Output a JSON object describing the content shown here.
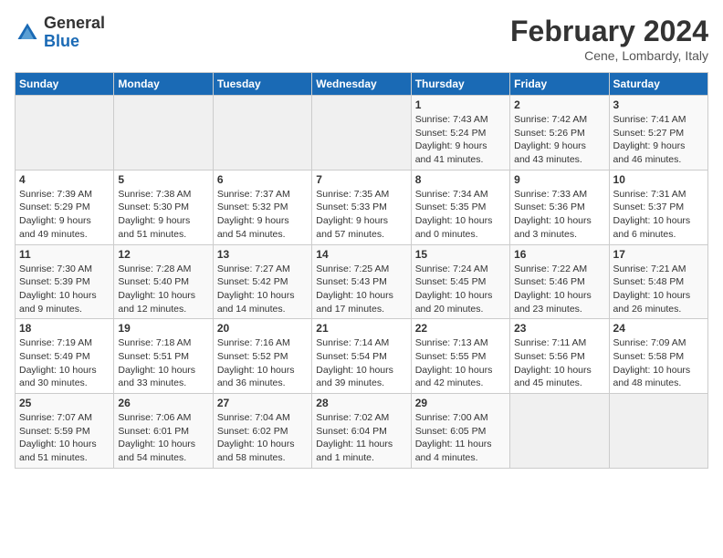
{
  "header": {
    "logo": {
      "general": "General",
      "blue": "Blue"
    },
    "title": "February 2024",
    "location": "Cene, Lombardy, Italy"
  },
  "calendar": {
    "days_of_week": [
      "Sunday",
      "Monday",
      "Tuesday",
      "Wednesday",
      "Thursday",
      "Friday",
      "Saturday"
    ],
    "weeks": [
      [
        {
          "day": "",
          "info": ""
        },
        {
          "day": "",
          "info": ""
        },
        {
          "day": "",
          "info": ""
        },
        {
          "day": "",
          "info": ""
        },
        {
          "day": "1",
          "info": "Sunrise: 7:43 AM\nSunset: 5:24 PM\nDaylight: 9 hours\nand 41 minutes."
        },
        {
          "day": "2",
          "info": "Sunrise: 7:42 AM\nSunset: 5:26 PM\nDaylight: 9 hours\nand 43 minutes."
        },
        {
          "day": "3",
          "info": "Sunrise: 7:41 AM\nSunset: 5:27 PM\nDaylight: 9 hours\nand 46 minutes."
        }
      ],
      [
        {
          "day": "4",
          "info": "Sunrise: 7:39 AM\nSunset: 5:29 PM\nDaylight: 9 hours\nand 49 minutes."
        },
        {
          "day": "5",
          "info": "Sunrise: 7:38 AM\nSunset: 5:30 PM\nDaylight: 9 hours\nand 51 minutes."
        },
        {
          "day": "6",
          "info": "Sunrise: 7:37 AM\nSunset: 5:32 PM\nDaylight: 9 hours\nand 54 minutes."
        },
        {
          "day": "7",
          "info": "Sunrise: 7:35 AM\nSunset: 5:33 PM\nDaylight: 9 hours\nand 57 minutes."
        },
        {
          "day": "8",
          "info": "Sunrise: 7:34 AM\nSunset: 5:35 PM\nDaylight: 10 hours\nand 0 minutes."
        },
        {
          "day": "9",
          "info": "Sunrise: 7:33 AM\nSunset: 5:36 PM\nDaylight: 10 hours\nand 3 minutes."
        },
        {
          "day": "10",
          "info": "Sunrise: 7:31 AM\nSunset: 5:37 PM\nDaylight: 10 hours\nand 6 minutes."
        }
      ],
      [
        {
          "day": "11",
          "info": "Sunrise: 7:30 AM\nSunset: 5:39 PM\nDaylight: 10 hours\nand 9 minutes."
        },
        {
          "day": "12",
          "info": "Sunrise: 7:28 AM\nSunset: 5:40 PM\nDaylight: 10 hours\nand 12 minutes."
        },
        {
          "day": "13",
          "info": "Sunrise: 7:27 AM\nSunset: 5:42 PM\nDaylight: 10 hours\nand 14 minutes."
        },
        {
          "day": "14",
          "info": "Sunrise: 7:25 AM\nSunset: 5:43 PM\nDaylight: 10 hours\nand 17 minutes."
        },
        {
          "day": "15",
          "info": "Sunrise: 7:24 AM\nSunset: 5:45 PM\nDaylight: 10 hours\nand 20 minutes."
        },
        {
          "day": "16",
          "info": "Sunrise: 7:22 AM\nSunset: 5:46 PM\nDaylight: 10 hours\nand 23 minutes."
        },
        {
          "day": "17",
          "info": "Sunrise: 7:21 AM\nSunset: 5:48 PM\nDaylight: 10 hours\nand 26 minutes."
        }
      ],
      [
        {
          "day": "18",
          "info": "Sunrise: 7:19 AM\nSunset: 5:49 PM\nDaylight: 10 hours\nand 30 minutes."
        },
        {
          "day": "19",
          "info": "Sunrise: 7:18 AM\nSunset: 5:51 PM\nDaylight: 10 hours\nand 33 minutes."
        },
        {
          "day": "20",
          "info": "Sunrise: 7:16 AM\nSunset: 5:52 PM\nDaylight: 10 hours\nand 36 minutes."
        },
        {
          "day": "21",
          "info": "Sunrise: 7:14 AM\nSunset: 5:54 PM\nDaylight: 10 hours\nand 39 minutes."
        },
        {
          "day": "22",
          "info": "Sunrise: 7:13 AM\nSunset: 5:55 PM\nDaylight: 10 hours\nand 42 minutes."
        },
        {
          "day": "23",
          "info": "Sunrise: 7:11 AM\nSunset: 5:56 PM\nDaylight: 10 hours\nand 45 minutes."
        },
        {
          "day": "24",
          "info": "Sunrise: 7:09 AM\nSunset: 5:58 PM\nDaylight: 10 hours\nand 48 minutes."
        }
      ],
      [
        {
          "day": "25",
          "info": "Sunrise: 7:07 AM\nSunset: 5:59 PM\nDaylight: 10 hours\nand 51 minutes."
        },
        {
          "day": "26",
          "info": "Sunrise: 7:06 AM\nSunset: 6:01 PM\nDaylight: 10 hours\nand 54 minutes."
        },
        {
          "day": "27",
          "info": "Sunrise: 7:04 AM\nSunset: 6:02 PM\nDaylight: 10 hours\nand 58 minutes."
        },
        {
          "day": "28",
          "info": "Sunrise: 7:02 AM\nSunset: 6:04 PM\nDaylight: 11 hours\nand 1 minute."
        },
        {
          "day": "29",
          "info": "Sunrise: 7:00 AM\nSunset: 6:05 PM\nDaylight: 11 hours\nand 4 minutes."
        },
        {
          "day": "",
          "info": ""
        },
        {
          "day": "",
          "info": ""
        }
      ]
    ]
  }
}
